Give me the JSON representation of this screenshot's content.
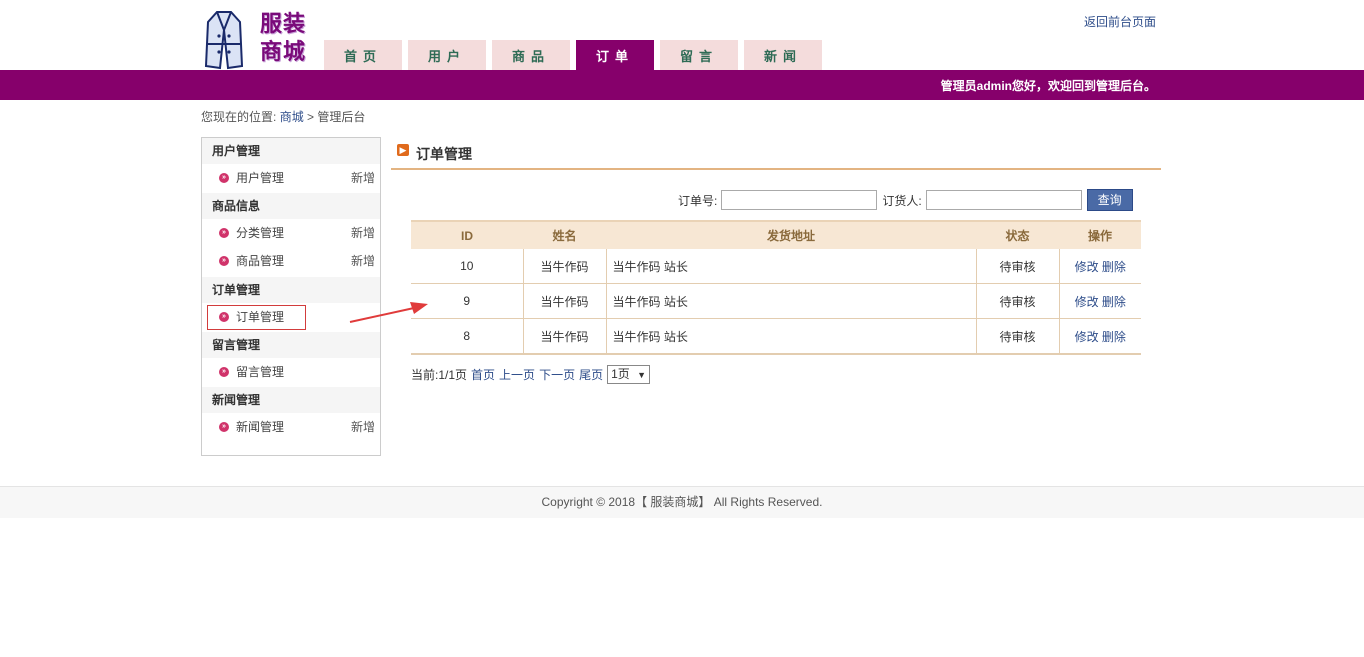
{
  "logo": {
    "line1": "服装",
    "line2": "商城"
  },
  "nav": [
    "首页",
    "用户",
    "商品",
    "订单",
    "留言",
    "新闻"
  ],
  "back_link": "返回前台页面",
  "welcome": "管理员admin您好，欢迎回到管理后台。",
  "breadcrumb": {
    "prefix": "您现在的位置:",
    "home": "商城",
    "sep": ">",
    "current": "管理后台"
  },
  "sidebar": {
    "g1": "用户管理",
    "g1_i1": "用户管理",
    "g1_i1_add": "新增",
    "g2": "商品信息",
    "g2_i1": "分类管理",
    "g2_i1_add": "新增",
    "g2_i2": "商品管理",
    "g2_i2_add": "新增",
    "g3": "订单管理",
    "g3_i1": "订单管理",
    "g4": "留言管理",
    "g4_i1": "留言管理",
    "g5": "新闻管理",
    "g5_i1": "新闻管理",
    "g5_i1_add": "新增"
  },
  "main": {
    "title": "订单管理"
  },
  "search": {
    "order_label": "订单号:",
    "buyer_label": "订货人:",
    "button": "查询"
  },
  "table": {
    "headers": [
      "ID",
      "姓名",
      "发货地址",
      "状态",
      "操作"
    ],
    "rows": [
      {
        "id": "10",
        "name": "当牛作码",
        "address": "当牛作码 站长",
        "status": "待审核",
        "edit": "修改",
        "del": "删除"
      },
      {
        "id": "9",
        "name": "当牛作码",
        "address": "当牛作码 站长",
        "status": "待审核",
        "edit": "修改",
        "del": "删除"
      },
      {
        "id": "8",
        "name": "当牛作码",
        "address": "当牛作码 站长",
        "status": "待审核",
        "edit": "修改",
        "del": "删除"
      }
    ]
  },
  "pager": {
    "current": "当前:1/1页",
    "first": "首页",
    "prev": "上一页",
    "next": "下一页",
    "last": "尾页",
    "select": "1页"
  },
  "footer": "Copyright © 2018【 服装商城】 All Rights Reserved.",
  "colors": {
    "brand": "#86006b",
    "tab": "#f4dcdc",
    "table_head": "#f7e7d4"
  }
}
